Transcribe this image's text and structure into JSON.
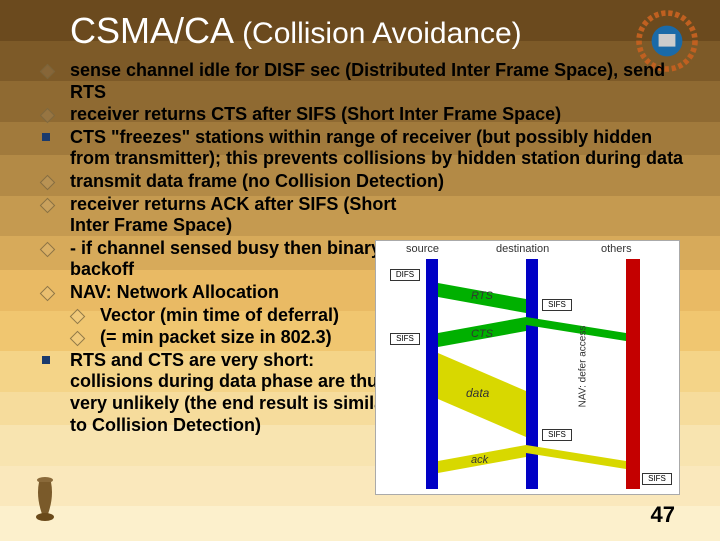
{
  "title_main": "CSMA/CA",
  "title_paren": "(Collision Avoidance)",
  "bullets": [
    {
      "style": "diamond",
      "text": "sense channel idle for DISF sec (Distributed Inter Frame Space), send RTS"
    },
    {
      "style": "diamond",
      "text": "receiver returns CTS after SIFS (Short Inter Frame Space)"
    },
    {
      "style": "square",
      "text": "CTS \"freezes\" stations within range of receiver (but possibly hidden from transmitter); this prevents collisions by hidden station during data"
    },
    {
      "style": "diamond",
      "text": "transmit data frame (no Collision Detection)"
    },
    {
      "style": "diamond",
      "text": "receiver returns ACK after SIFS (Short Inter Frame Space)",
      "wrap": true
    },
    {
      "style": "diamond",
      "text": "- if channel sensed busy then binary backoff",
      "wrap": true
    },
    {
      "style": "diamond",
      "text": "NAV: Network Allocation",
      "wrap": true
    },
    {
      "style": "diamond",
      "text": "Vector (min time of deferral)",
      "wrap": true,
      "sub": true
    },
    {
      "style": "diamond",
      "text": "(= min packet size in 802.3)",
      "wrap": true,
      "sub": true
    },
    {
      "style": "square",
      "text": "RTS and CTS are very short: collisions during data phase are thus very unlikely (the end result is similar to Collision Detection)",
      "wrap": true
    }
  ],
  "diagram": {
    "labels": {
      "src": "source",
      "dst": "destination",
      "oth": "others"
    },
    "boxes": {
      "difs": "DIFS",
      "sifs": "SIFS"
    },
    "msgs": {
      "rts": "RTS",
      "cts": "CTS",
      "data": "data",
      "ack": "ack"
    },
    "nav": "NAV: defer access"
  },
  "page_number": "47",
  "bg_colors": [
    "#6b4a1e",
    "#7d5a28",
    "#8f6a32",
    "#a17a3c",
    "#b38a46",
    "#c59a50",
    "#d7aa5a",
    "#e9ba64",
    "#f0c670",
    "#f4d488",
    "#f6dc9c",
    "#f8e4b0",
    "#fae8bc",
    "#fcf0cc"
  ]
}
